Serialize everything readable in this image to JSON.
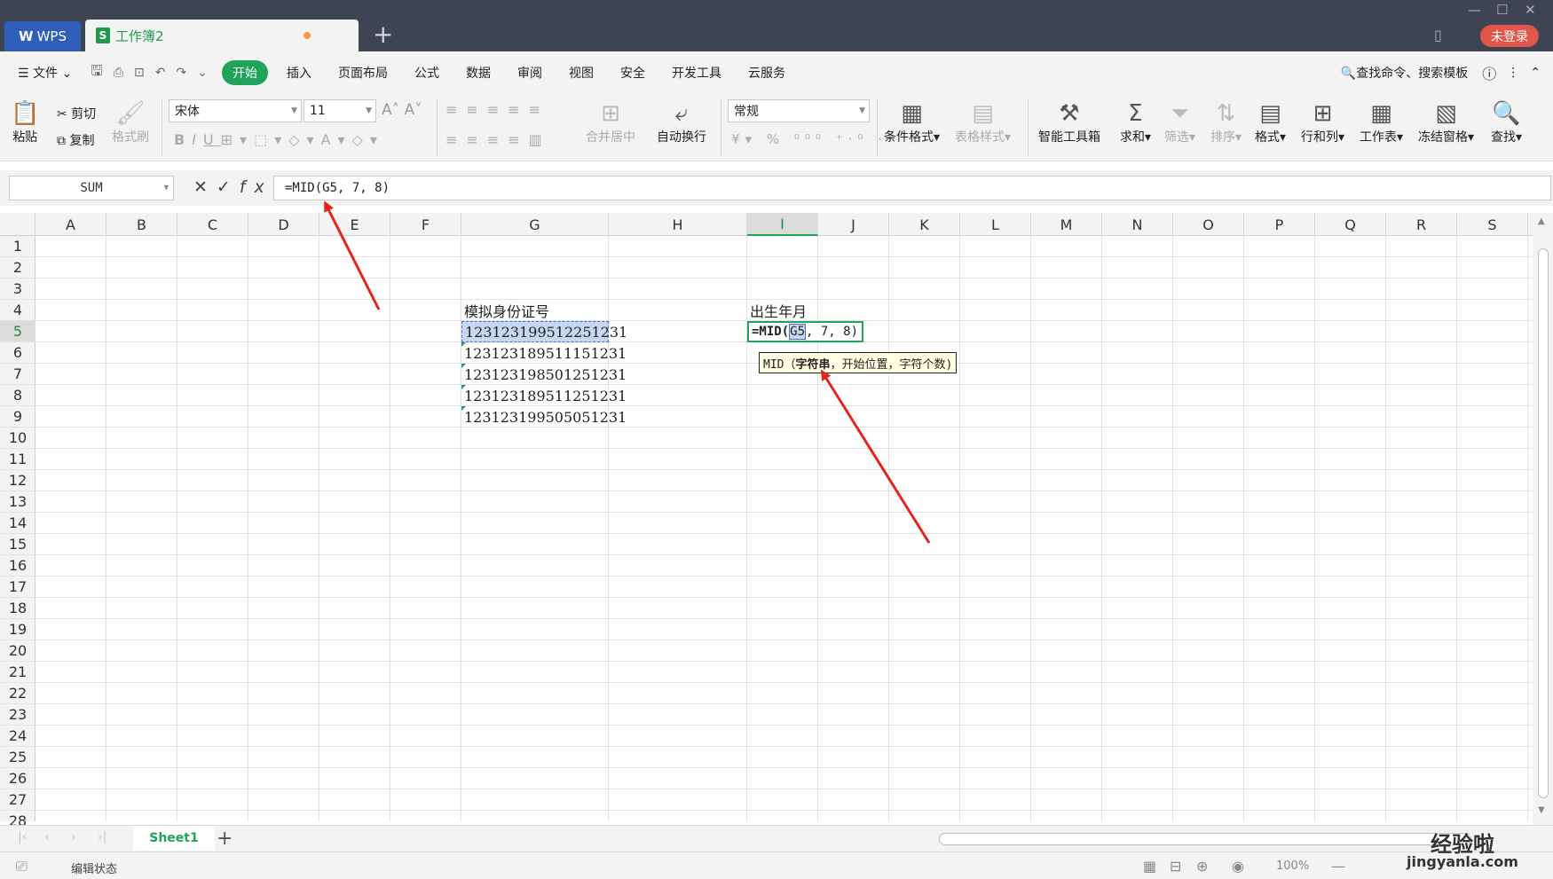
{
  "tabs": {
    "wps": "WPS",
    "book": "工作簿2",
    "book_icon": "S",
    "add": "+"
  },
  "window": {
    "login": "未登录"
  },
  "menu": {
    "file": "文件",
    "items": [
      "开始",
      "插入",
      "页面布局",
      "公式",
      "数据",
      "审阅",
      "视图",
      "安全",
      "开发工具",
      "云服务"
    ],
    "search": "查找命令、搜索模板"
  },
  "ribbon": {
    "paste": "粘贴",
    "cut": "剪切",
    "copy": "复制",
    "format_painter": "格式刷",
    "font_name": "宋体",
    "font_size": "11",
    "merge_center": "合并居中",
    "wrap_text": "自动换行",
    "number_format": "常规",
    "cond_format": "条件格式",
    "table_style": "表格样式",
    "smart_toolbox": "智能工具箱",
    "sum": "求和",
    "filter": "筛选",
    "sort": "排序",
    "format": "格式",
    "rows_cols": "行和列",
    "worksheet": "工作表",
    "freeze": "冻结窗格",
    "find": "查找"
  },
  "formula_bar": {
    "name_box": "SUM",
    "fx": "fx",
    "formula": "=MID(G5, 7, 8)"
  },
  "grid": {
    "columns": [
      "A",
      "B",
      "C",
      "D",
      "E",
      "F",
      "G",
      "H",
      "I",
      "J",
      "K",
      "L",
      "M",
      "N",
      "O",
      "P",
      "Q",
      "R",
      "S"
    ],
    "rows": [
      "1",
      "2",
      "3",
      "4",
      "5",
      "6",
      "7",
      "8",
      "9",
      "10",
      "11",
      "12",
      "13",
      "14",
      "15",
      "16",
      "17",
      "18",
      "19",
      "20",
      "21",
      "22",
      "23",
      "24",
      "25",
      "26",
      "27",
      "28"
    ],
    "selected_column": "I",
    "selected_row": "5",
    "g4": "模拟身份证号",
    "g_values": [
      "123123199512251231",
      "123123189511151231",
      "123123198501251231",
      "123123189511251231",
      "123123199505051231"
    ],
    "i4": "出生年月",
    "i5_prefix": "=MID(",
    "i5_ref": "G5",
    "i5_suffix": ", 7, 8)",
    "tooltip_fn": "MID（",
    "tooltip_bold": "字符串",
    "tooltip_rest": "，开始位置，字符个数)"
  },
  "sheets": {
    "active": "Sheet1"
  },
  "status": {
    "mode": "编辑状态",
    "zoom": "100%"
  },
  "watermark": {
    "line1": "经验啦",
    "line2": "jingyanla.com"
  },
  "colors": {
    "accent": "#20a35a",
    "titlebar": "#3e4451",
    "arrow": "#e8231b",
    "login": "#e0564b"
  }
}
